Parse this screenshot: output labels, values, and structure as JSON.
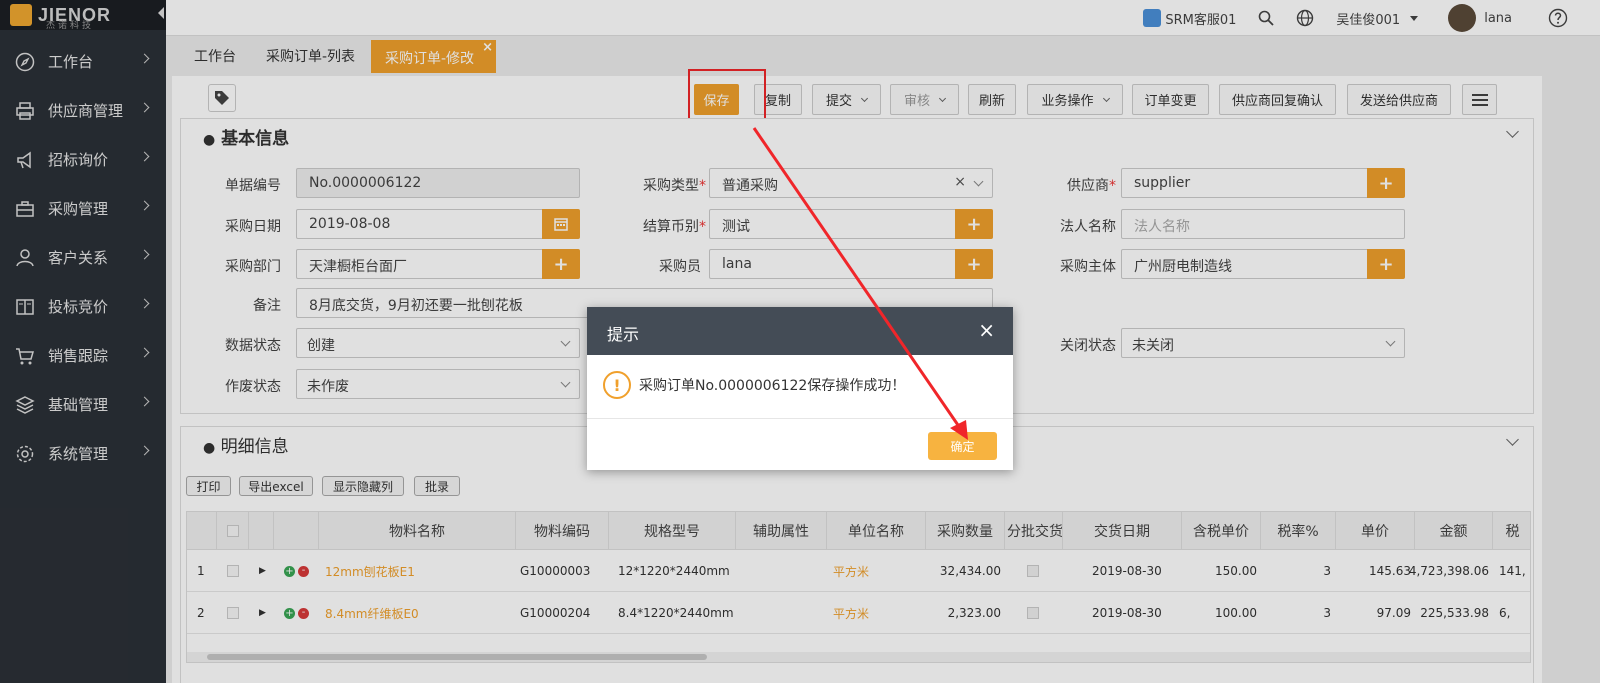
{
  "logo": {
    "text": "JIENOR",
    "sub": "杰诺科技"
  },
  "sidebar": {
    "items": [
      {
        "label": "工作台",
        "icon": "compass-icon"
      },
      {
        "label": "供应商管理",
        "icon": "printer-icon"
      },
      {
        "label": "招标询价",
        "icon": "megaphone-icon"
      },
      {
        "label": "采购管理",
        "icon": "briefcase-icon"
      },
      {
        "label": "客户关系",
        "icon": "user-icon"
      },
      {
        "label": "投标竞价",
        "icon": "book-icon"
      },
      {
        "label": "销售跟踪",
        "icon": "cart-icon"
      },
      {
        "label": "基础管理",
        "icon": "layers-icon"
      },
      {
        "label": "系统管理",
        "icon": "gear-icon"
      }
    ]
  },
  "topbar": {
    "service": "SRM客服01",
    "user": "吴佳俊001",
    "name": "lana"
  },
  "tabs": [
    {
      "label": "工作台"
    },
    {
      "label": "采购订单-列表"
    },
    {
      "label": "采购订单-修改",
      "close": "×"
    }
  ],
  "toolbar": {
    "save": "保存",
    "copy": "复制",
    "submit": "提交",
    "audit": "审核",
    "refresh": "刷新",
    "business": "业务操作",
    "change": "订单变更",
    "supplier_confirm": "供应商回复确认",
    "send_supplier": "发送给供应商"
  },
  "basic": {
    "title": "基本信息",
    "doc_no_label": "单据编号",
    "doc_no": "No.0000006122",
    "purchase_type_label": "采购类型",
    "purchase_type": "普通采购",
    "clear": "×",
    "supplier_label": "供应商",
    "supplier": "supplier",
    "date_label": "采购日期",
    "date": "2019-08-08",
    "currency_label": "结算币别",
    "currency": "测试",
    "legal_label": "法人名称",
    "legal_placeholder": "法人名称",
    "dept_label": "采购部门",
    "dept": "天津橱柜台面厂",
    "buyer_label": "采购员",
    "buyer": "lana",
    "subject_label": "采购主体",
    "subject": "广州厨电制造线",
    "remark_label": "备注",
    "remark": "8月底交货，9月初还要一批刨花板",
    "data_status_label": "数据状态",
    "data_status": "创建",
    "close_status_label": "关闭状态",
    "close_status": "未关闭",
    "void_status_label": "作废状态",
    "void_status": "未作废",
    "required_mark": "*",
    "add": "+"
  },
  "detail": {
    "title": "明细信息",
    "buttons": [
      "打印",
      "导出excel",
      "显示隐藏列",
      "批录"
    ],
    "columns": [
      "物料名称",
      "物料编码",
      "规格型号",
      "辅助属性",
      "单位名称",
      "采购数量",
      "分批交货",
      "交货日期",
      "含税单价",
      "税率%",
      "单价",
      "金额",
      "税"
    ],
    "rows": [
      {
        "no": "1",
        "name": "12mm刨花板E1",
        "code": "G10000003",
        "spec": "12*1220*2440mm",
        "unit": "平方米",
        "qty": "32,434.00",
        "date": "2019-08-30",
        "tax_price": "150.00",
        "rate": "3",
        "price": "145.63",
        "amount": "4,723,398.06",
        "tax": "141,"
      },
      {
        "no": "2",
        "name": "8.4mm纤维板E0",
        "code": "G10000204",
        "spec": "8.4*1220*2440mm",
        "unit": "平方米",
        "qty": "2,323.00",
        "date": "2019-08-30",
        "tax_price": "100.00",
        "rate": "3",
        "price": "97.09",
        "amount": "225,533.98",
        "tax": "6,"
      }
    ]
  },
  "modal": {
    "title": "提示",
    "close": "×",
    "warn": "!",
    "message": "采购订单No.0000006122保存操作成功！",
    "ok": "确定"
  },
  "colors": {
    "accent": "#f0a02c",
    "sidebar": "#2b3037",
    "annotation": "#f0262a"
  }
}
